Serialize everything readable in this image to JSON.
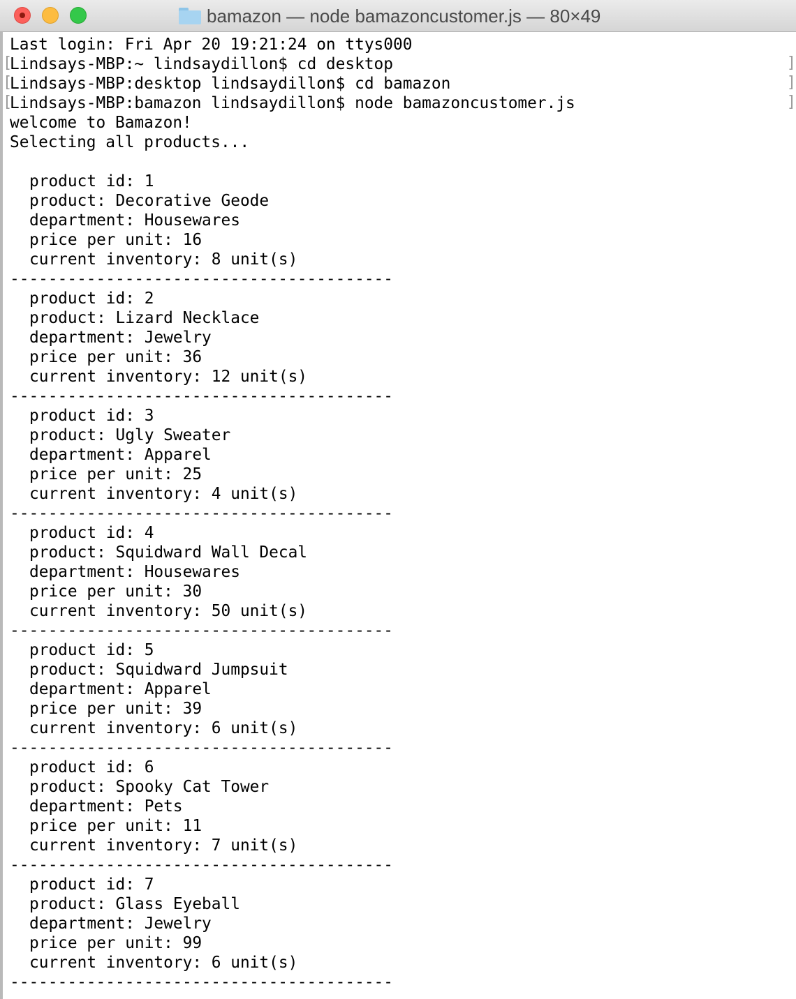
{
  "window": {
    "title": "bamazon — node bamazoncustomer.js — 80×49"
  },
  "terminal": {
    "last_login": "Last login: Fri Apr 20 19:21:24 on ttys000",
    "commands": [
      "Lindsays-MBP:~ lindsaydillon$ cd desktop",
      "Lindsays-MBP:desktop lindsaydillon$ cd bamazon",
      "Lindsays-MBP:bamazon lindsaydillon$ node bamazoncustomer.js"
    ],
    "welcome": "welcome to Bamazon!",
    "selecting": "Selecting all products...",
    "separator": "----------------------------------------",
    "products": [
      {
        "id": "product id: 1",
        "name": "product: Decorative Geode",
        "department": "department: Housewares",
        "price": "price per unit: 16",
        "inventory": "current inventory: 8 unit(s)"
      },
      {
        "id": "product id: 2",
        "name": "product: Lizard Necklace",
        "department": "department: Jewelry",
        "price": "price per unit: 36",
        "inventory": "current inventory: 12 unit(s)"
      },
      {
        "id": "product id: 3",
        "name": "product: Ugly Sweater",
        "department": "department: Apparel",
        "price": "price per unit: 25",
        "inventory": "current inventory: 4 unit(s)"
      },
      {
        "id": "product id: 4",
        "name": "product: Squidward Wall Decal",
        "department": "department: Housewares",
        "price": "price per unit: 30",
        "inventory": "current inventory: 50 unit(s)"
      },
      {
        "id": "product id: 5",
        "name": "product: Squidward Jumpsuit",
        "department": "department: Apparel",
        "price": "price per unit: 39",
        "inventory": "current inventory: 6 unit(s)"
      },
      {
        "id": "product id: 6",
        "name": "product: Spooky Cat Tower",
        "department": "department: Pets",
        "price": "price per unit: 11",
        "inventory": "current inventory: 7 unit(s)"
      },
      {
        "id": "product id: 7",
        "name": "product: Glass Eyeball",
        "department": "department: Jewelry",
        "price": "price per unit: 99",
        "inventory": "current inventory: 6 unit(s)"
      }
    ]
  },
  "colors": {
    "close": "#fc605b",
    "minimize": "#fdbc40",
    "zoom": "#34c84a",
    "folder": "#a7d4f1"
  },
  "icons": [
    "close-icon",
    "minimize-icon",
    "zoom-icon",
    "folder-icon"
  ]
}
